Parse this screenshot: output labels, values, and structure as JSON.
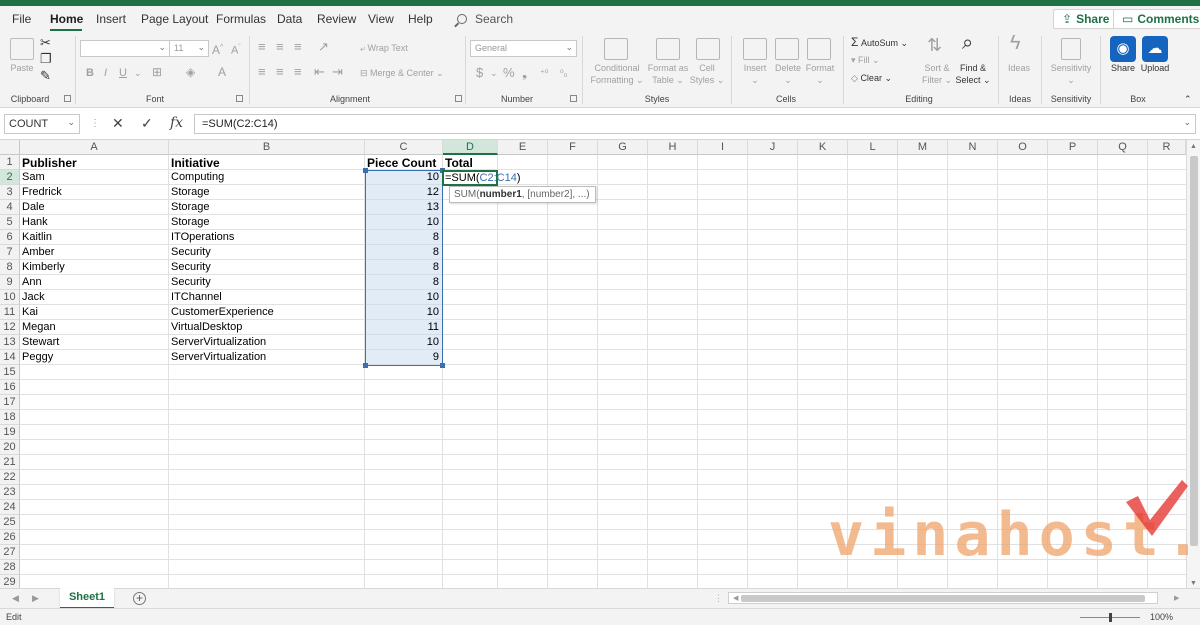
{
  "menu_tabs": [
    "File",
    "Home",
    "Insert",
    "Page Layout",
    "Formulas",
    "Data",
    "Review",
    "View",
    "Help"
  ],
  "search_label": "Search",
  "top_buttons": {
    "share": "Share",
    "comments": "Comments"
  },
  "ribbon": {
    "clipboard": {
      "label": "Clipboard",
      "paste": "Paste"
    },
    "font": {
      "label": "Font",
      "size": "11",
      "font_name": ""
    },
    "alignment": {
      "label": "Alignment",
      "wrap_text": "Wrap Text",
      "merge_center": "Merge & Center"
    },
    "number": {
      "label": "Number",
      "format": "General"
    },
    "styles": {
      "label": "Styles",
      "conditional_formatting": [
        "Conditional",
        "Formatting"
      ],
      "format_as_table": [
        "Format as",
        "Table"
      ],
      "cell_styles": [
        "Cell",
        "Styles"
      ]
    },
    "cells": {
      "label": "Cells",
      "insert": "Insert",
      "delete": "Delete",
      "format": "Format"
    },
    "editing": {
      "label": "Editing",
      "autosum": "AutoSum",
      "fill": "Fill",
      "clear": "Clear",
      "sort_filter": [
        "Sort &",
        "Filter"
      ],
      "find_select": [
        "Find &",
        "Select"
      ]
    },
    "ideas": {
      "label": "Ideas",
      "ideas": "Ideas"
    },
    "sensitivity": {
      "label": "Sensitivity",
      "sensitivity": "Sensitivity"
    },
    "box": {
      "label": "Box",
      "share": "Share",
      "upload": "Upload"
    }
  },
  "formula_bar": {
    "name_box": "COUNT",
    "formula": "=SUM(C2:C14)"
  },
  "columns": [
    "A",
    "B",
    "C",
    "D",
    "E",
    "F",
    "G",
    "H",
    "I",
    "J",
    "K",
    "L",
    "M",
    "N",
    "O",
    "P",
    "Q",
    "R"
  ],
  "rows": [
    "1",
    "2",
    "3",
    "4",
    "5",
    "6",
    "7",
    "8",
    "9",
    "10",
    "11",
    "12",
    "13",
    "14",
    "15",
    "16",
    "17",
    "18",
    "19",
    "20",
    "21",
    "22",
    "23",
    "24",
    "25",
    "26",
    "27",
    "28",
    "29"
  ],
  "headers": {
    "a": "Publisher",
    "b": "Initiative",
    "c": "Piece Count",
    "d": "Total"
  },
  "data_rows": [
    {
      "publisher": "Sam",
      "initiative": "Computing",
      "count": "10"
    },
    {
      "publisher": "Fredrick",
      "initiative": "Storage",
      "count": "12"
    },
    {
      "publisher": "Dale",
      "initiative": "Storage",
      "count": "13"
    },
    {
      "publisher": "Hank",
      "initiative": "Storage",
      "count": "10"
    },
    {
      "publisher": "Kaitlin",
      "initiative": "ITOperations",
      "count": "8"
    },
    {
      "publisher": "Amber",
      "initiative": "Security",
      "count": "8"
    },
    {
      "publisher": "Kimberly",
      "initiative": "Security",
      "count": "8"
    },
    {
      "publisher": "Ann",
      "initiative": "Security",
      "count": "8"
    },
    {
      "publisher": "Jack",
      "initiative": "ITChannel",
      "count": "10"
    },
    {
      "publisher": "Kai",
      "initiative": "CustomerExperience",
      "count": "10"
    },
    {
      "publisher": "Megan",
      "initiative": "VirtualDesktop",
      "count": "11"
    },
    {
      "publisher": "Stewart",
      "initiative": "ServerVirtualization",
      "count": "10"
    },
    {
      "publisher": "Peggy",
      "initiative": "ServerVirtualization",
      "count": "9"
    }
  ],
  "active_cell": {
    "prefix": "=SUM(",
    "ref": "C2:C14",
    "suffix": ")"
  },
  "tooltip": {
    "fn": "SUM(",
    "arg1": "number1",
    "rest": ", [number2], ...)"
  },
  "sheet_tab": "Sheet1",
  "status": {
    "mode": "Edit",
    "zoom": "100%"
  },
  "watermark": "vinahost.",
  "colors": {
    "accent": "#1e7145",
    "range_border": "#3a6fb0",
    "box_blue": "#1565c0",
    "watermark": "#f0a36b",
    "check_red": "#e53935"
  }
}
